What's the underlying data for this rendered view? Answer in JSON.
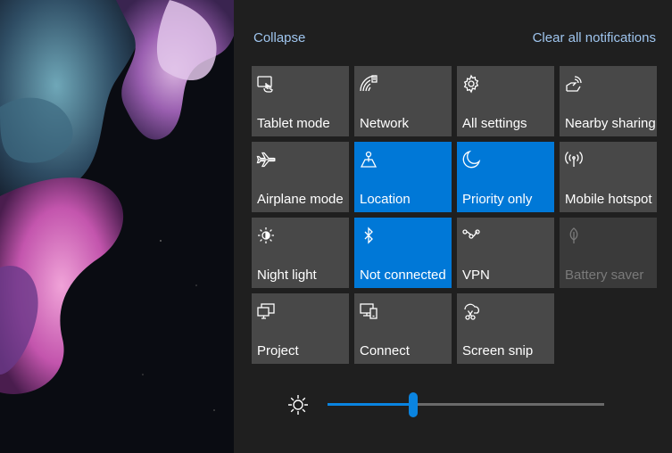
{
  "header": {
    "collapse_label": "Collapse",
    "clear_label": "Clear all notifications"
  },
  "tiles": [
    {
      "label": "Tablet mode",
      "icon": "tablet-mode-icon",
      "state": "off"
    },
    {
      "label": "Network",
      "icon": "network-icon",
      "state": "off"
    },
    {
      "label": "All settings",
      "icon": "gear-icon",
      "state": "off"
    },
    {
      "label": "Nearby sharing",
      "icon": "nearby-sharing-icon",
      "state": "off"
    },
    {
      "label": "Airplane mode",
      "icon": "airplane-icon",
      "state": "off"
    },
    {
      "label": "Location",
      "icon": "location-icon",
      "state": "on"
    },
    {
      "label": "Priority only",
      "icon": "moon-icon",
      "state": "on"
    },
    {
      "label": "Mobile hotspot",
      "icon": "hotspot-icon",
      "state": "off"
    },
    {
      "label": "Night light",
      "icon": "night-light-icon",
      "state": "off"
    },
    {
      "label": "Not connected",
      "icon": "bluetooth-icon",
      "state": "on"
    },
    {
      "label": "VPN",
      "icon": "vpn-icon",
      "state": "off"
    },
    {
      "label": "Battery saver",
      "icon": "leaf-icon",
      "state": "disabled"
    },
    {
      "label": "Project",
      "icon": "project-icon",
      "state": "off"
    },
    {
      "label": "Connect",
      "icon": "connect-icon",
      "state": "off"
    },
    {
      "label": "Screen snip",
      "icon": "screen-snip-icon",
      "state": "off"
    }
  ],
  "brightness": {
    "icon": "brightness-sun-icon",
    "level": 0.31
  },
  "colors": {
    "active_tile": "#0078d7",
    "tile": "#484848",
    "link": "#9fc5ee"
  }
}
